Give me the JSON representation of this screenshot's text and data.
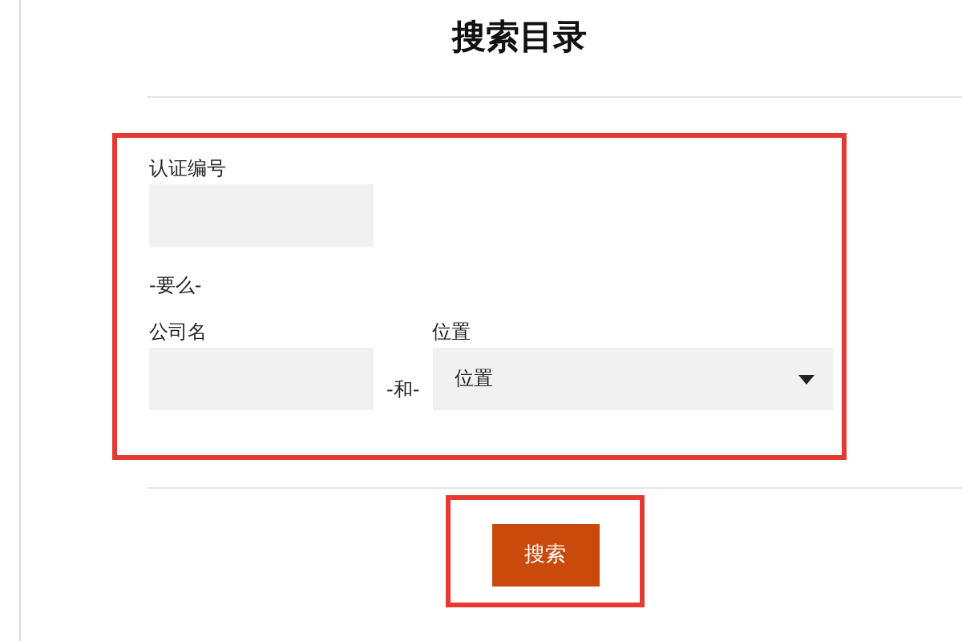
{
  "title": "搜索目录",
  "cert_field": {
    "label": "认证编号"
  },
  "or_text": "-要么-",
  "company_field": {
    "label": "公司名"
  },
  "and_text": "-和-",
  "location_field": {
    "label": "位置",
    "value": "位置"
  },
  "search_button": "搜索"
}
